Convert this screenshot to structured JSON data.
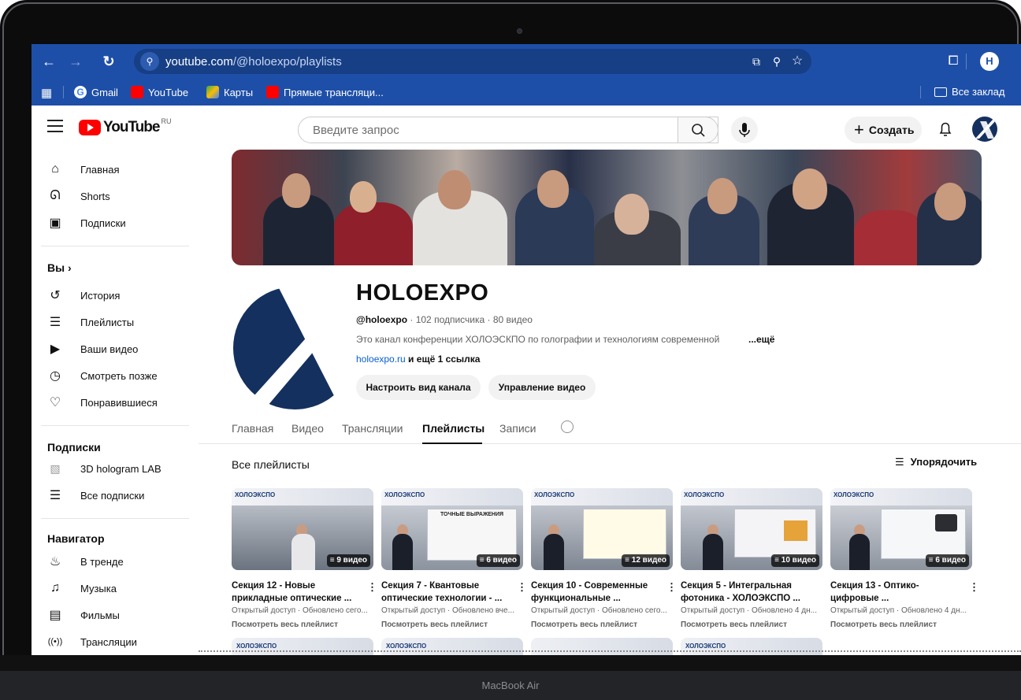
{
  "browser": {
    "url_host": "youtube.com",
    "url_path": "/@holoexpo/playlists",
    "profile_initial": "H",
    "bookmarks": [
      {
        "label": "Gmail",
        "icon": "google-icon",
        "color": "#4285f4"
      },
      {
        "label": "YouTube",
        "icon": "youtube-icon",
        "color": "#ff0000"
      },
      {
        "label": "Карты",
        "icon": "maps-icon",
        "color": "#34a853"
      },
      {
        "label": "Прямые трансляци...",
        "icon": "youtube-icon",
        "color": "#ff0000"
      }
    ],
    "all_bookmarks": "Все заклад"
  },
  "masthead": {
    "logo_text": "YouTube",
    "region": "RU",
    "search_placeholder": "Введите запрос",
    "create_label": "Создать"
  },
  "sidebar": {
    "main": [
      {
        "label": "Главная",
        "icon": "home-icon",
        "glyph": "⌂"
      },
      {
        "label": "Shorts",
        "icon": "shorts-icon",
        "glyph": "ᕲ"
      },
      {
        "label": "Подписки",
        "icon": "subscriptions-icon",
        "glyph": "▣"
      }
    ],
    "you_header": "Вы",
    "you": [
      {
        "label": "История",
        "icon": "history-icon",
        "glyph": "↺"
      },
      {
        "label": "Плейлисты",
        "icon": "playlists-icon",
        "glyph": "☰"
      },
      {
        "label": "Ваши видео",
        "icon": "your-videos-icon",
        "glyph": "▶"
      },
      {
        "label": "Смотреть позже",
        "icon": "watch-later-icon",
        "glyph": "◷"
      },
      {
        "label": "Понравившиеся",
        "icon": "like-icon",
        "glyph": "👍"
      }
    ],
    "subs_header": "Подписки",
    "subs": [
      {
        "label": "3D hologram LAB",
        "icon": "channel-avatar-icon",
        "glyph": "▧"
      },
      {
        "label": "Все подписки",
        "icon": "list-icon",
        "glyph": "☰"
      }
    ],
    "nav_header": "Навигатор",
    "nav": [
      {
        "label": "В тренде",
        "icon": "trending-icon",
        "glyph": "✇"
      },
      {
        "label": "Музыка",
        "icon": "music-icon",
        "glyph": "♫"
      },
      {
        "label": "Фильмы",
        "icon": "movies-icon",
        "glyph": "▤"
      },
      {
        "label": "Трансляции",
        "icon": "live-icon",
        "glyph": "((•))"
      }
    ]
  },
  "channel": {
    "name": "HOLOEXPO",
    "handle": "@holoexpo",
    "stats": " · 102 подписчика · 80 видео",
    "description": "Это канал конференции ХОЛОЭСКПО по голографии и технологиям современной",
    "more": "...ещё",
    "link": "holoexpo.ru",
    "link_more": " и ещё 1 ссылка",
    "customize_button": "Настроить вид канала",
    "manage_button": "Управление видео"
  },
  "tabs": [
    {
      "label": "Главная",
      "active": false
    },
    {
      "label": "Видео",
      "active": false
    },
    {
      "label": "Трансляции",
      "active": false
    },
    {
      "label": "Плейлисты",
      "active": true
    },
    {
      "label": "Записи",
      "active": false
    }
  ],
  "section": {
    "title": "Все плейлисты",
    "sort_label": "Упорядочить"
  },
  "playlists": [
    {
      "title": "Секция 12 - Новые прикладные оптические ...",
      "count": "9 видео",
      "meta": "Открытый доступ · Обновлено сего...",
      "link": "Посмотреть весь плейлист",
      "brand": "ХОЛОЭКСПО"
    },
    {
      "title": "Секция 7 - Квантовые оптические технологии - ...",
      "count": "6 видео",
      "meta": "Открытый доступ · Обновлено вче...",
      "link": "Посмотреть весь плейлист",
      "brand": "ХОЛОЭКСПО",
      "slide_title": "ТОЧНЫЕ ВЫРАЖЕНИЯ"
    },
    {
      "title": "Секция 10 - Современные функциональные ...",
      "count": "12 видео",
      "meta": "Открытый доступ · Обновлено сего...",
      "link": "Посмотреть весь плейлист",
      "brand": "ХОЛОЭКСПО"
    },
    {
      "title": "Секция 5 - Интегральная фотоника - ХОЛОЭКСПО ...",
      "count": "10 видео",
      "meta": "Открытый доступ · Обновлено 4 дн...",
      "link": "Посмотреть весь плейлист",
      "brand": "ХОЛОЭКСПО"
    },
    {
      "title": "Секция 13 - Оптико-цифровые ...",
      "count": "6 видео",
      "meta": "Открытый доступ · Обновлено 4 дн...",
      "link": "Посмотреть весь плейлист",
      "brand": "ХОЛОЭКСПО"
    }
  ],
  "row2_brands": [
    "ХОЛОЭКСПО",
    "ХОЛОЭКСПО",
    "",
    "ХОЛОЭКСПО"
  ],
  "device_label": "MacBook Air",
  "colors": {
    "chrome_blue": "#1e4fa8",
    "yt_red": "#ff0000",
    "brand_navy": "#14305f"
  }
}
